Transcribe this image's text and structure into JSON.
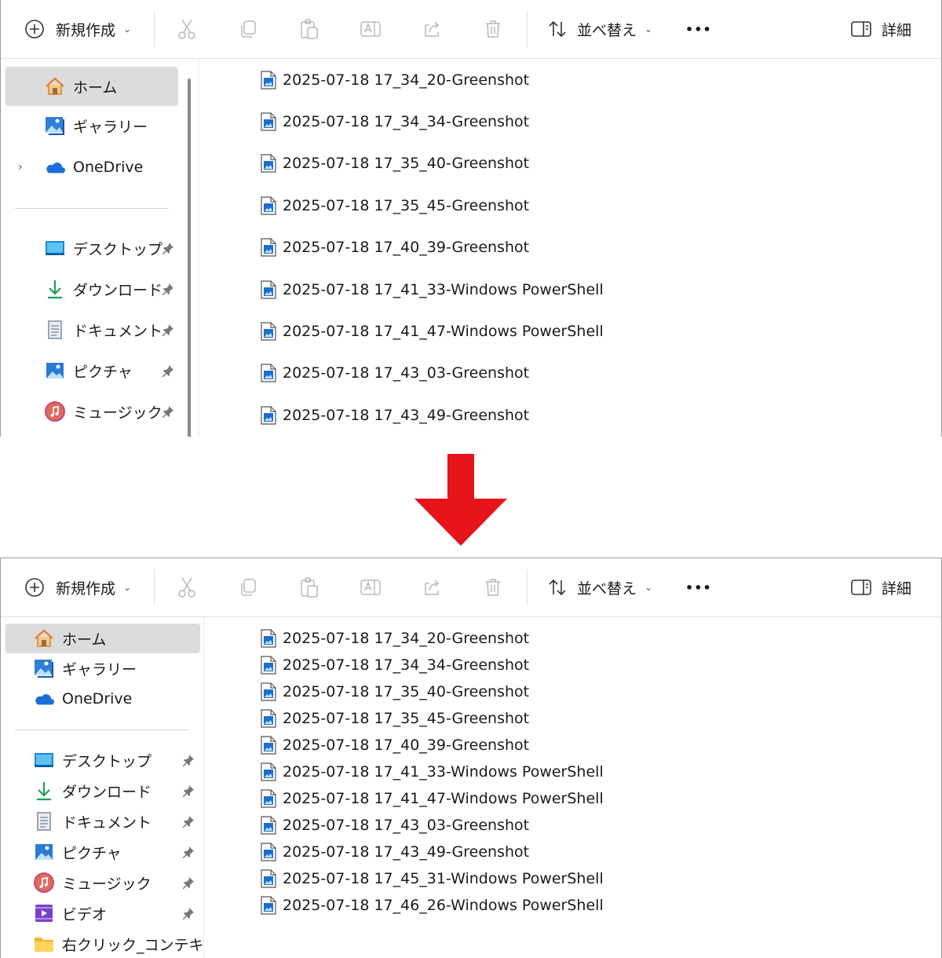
{
  "toolbar": {
    "new_label": "新規作成",
    "sort_label": "並べ替え",
    "more_label": "•••",
    "details_label": "詳細"
  },
  "colors": {
    "arrow": "#e8141c",
    "accent": "#0067c0",
    "selected_bg": "#dcdcdc"
  },
  "top": {
    "nav": {
      "home": "ホーム",
      "gallery": "ギャラリー",
      "onedrive": "OneDrive",
      "desktop": "デスクトップ",
      "downloads": "ダウンロード",
      "documents": "ドキュメント",
      "pictures": "ピクチャ",
      "music": "ミュージック"
    },
    "files": [
      "2025-07-18 17_34_20-Greenshot",
      "2025-07-18 17_34_34-Greenshot",
      "2025-07-18 17_35_40-Greenshot",
      "2025-07-18 17_35_45-Greenshot",
      "2025-07-18 17_40_39-Greenshot",
      "2025-07-18 17_41_33-Windows PowerShell",
      "2025-07-18 17_41_47-Windows PowerShell",
      "2025-07-18 17_43_03-Greenshot",
      "2025-07-18 17_43_49-Greenshot"
    ]
  },
  "bottom": {
    "nav": {
      "home": "ホーム",
      "gallery": "ギャラリー",
      "onedrive": "OneDrive",
      "desktop": "デスクトップ",
      "downloads": "ダウンロード",
      "documents": "ドキュメント",
      "pictures": "ピクチャ",
      "music": "ミュージック",
      "videos": "ビデオ",
      "folder": "右クリック_コンテキストメ"
    },
    "files": [
      "2025-07-18 17_34_20-Greenshot",
      "2025-07-18 17_34_34-Greenshot",
      "2025-07-18 17_35_40-Greenshot",
      "2025-07-18 17_35_45-Greenshot",
      "2025-07-18 17_40_39-Greenshot",
      "2025-07-18 17_41_33-Windows PowerShell",
      "2025-07-18 17_41_47-Windows PowerShell",
      "2025-07-18 17_43_03-Greenshot",
      "2025-07-18 17_43_49-Greenshot",
      "2025-07-18 17_45_31-Windows PowerShell",
      "2025-07-18 17_46_26-Windows PowerShell"
    ]
  }
}
